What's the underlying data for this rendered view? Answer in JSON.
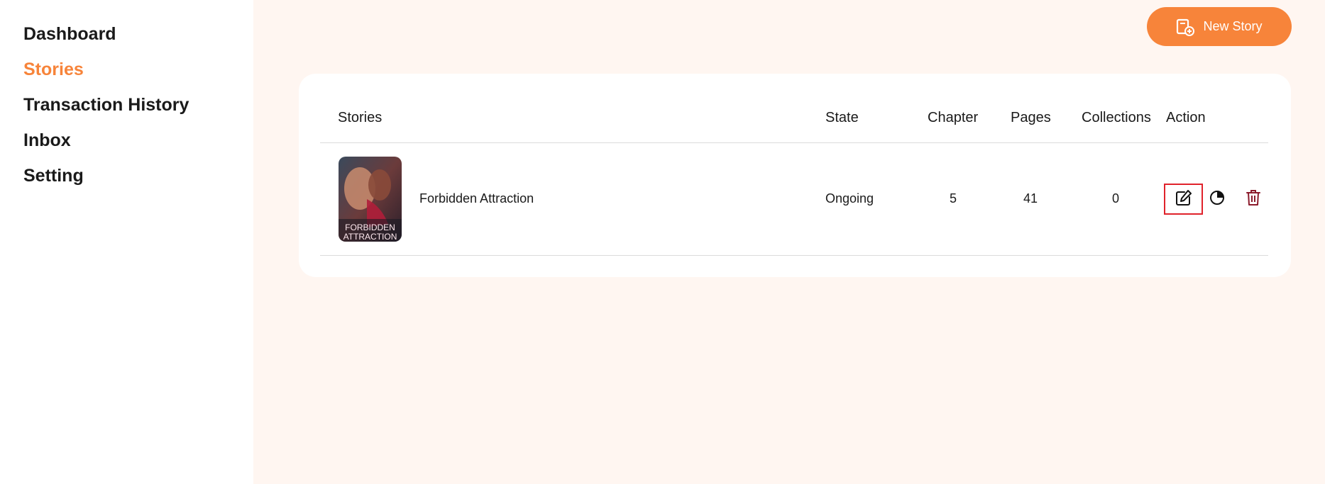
{
  "sidebar": {
    "items": [
      {
        "label": "Dashboard",
        "active": false
      },
      {
        "label": "Stories",
        "active": true
      },
      {
        "label": "Transaction History",
        "active": false
      },
      {
        "label": "Inbox",
        "active": false
      },
      {
        "label": "Setting",
        "active": false
      }
    ]
  },
  "header": {
    "new_story_label": "New Story",
    "new_story_icon": "new-document-icon"
  },
  "table": {
    "columns": [
      "Stories",
      "State",
      "Chapter",
      "Pages",
      "Collections",
      "Action"
    ],
    "rows": [
      {
        "cover_text": [
          "FORBIDDEN",
          "ATTRACTION"
        ],
        "title": "Forbidden Attraction",
        "state": "Ongoing",
        "chapter": "5",
        "pages": "41",
        "collections": "0",
        "actions": [
          "edit-icon",
          "stats-pie-icon",
          "trash-icon"
        ]
      }
    ]
  },
  "colors": {
    "accent": "#f7843a",
    "background": "#fff6f1",
    "delete": "#8b1a2b",
    "highlight_border": "#e0222b"
  }
}
